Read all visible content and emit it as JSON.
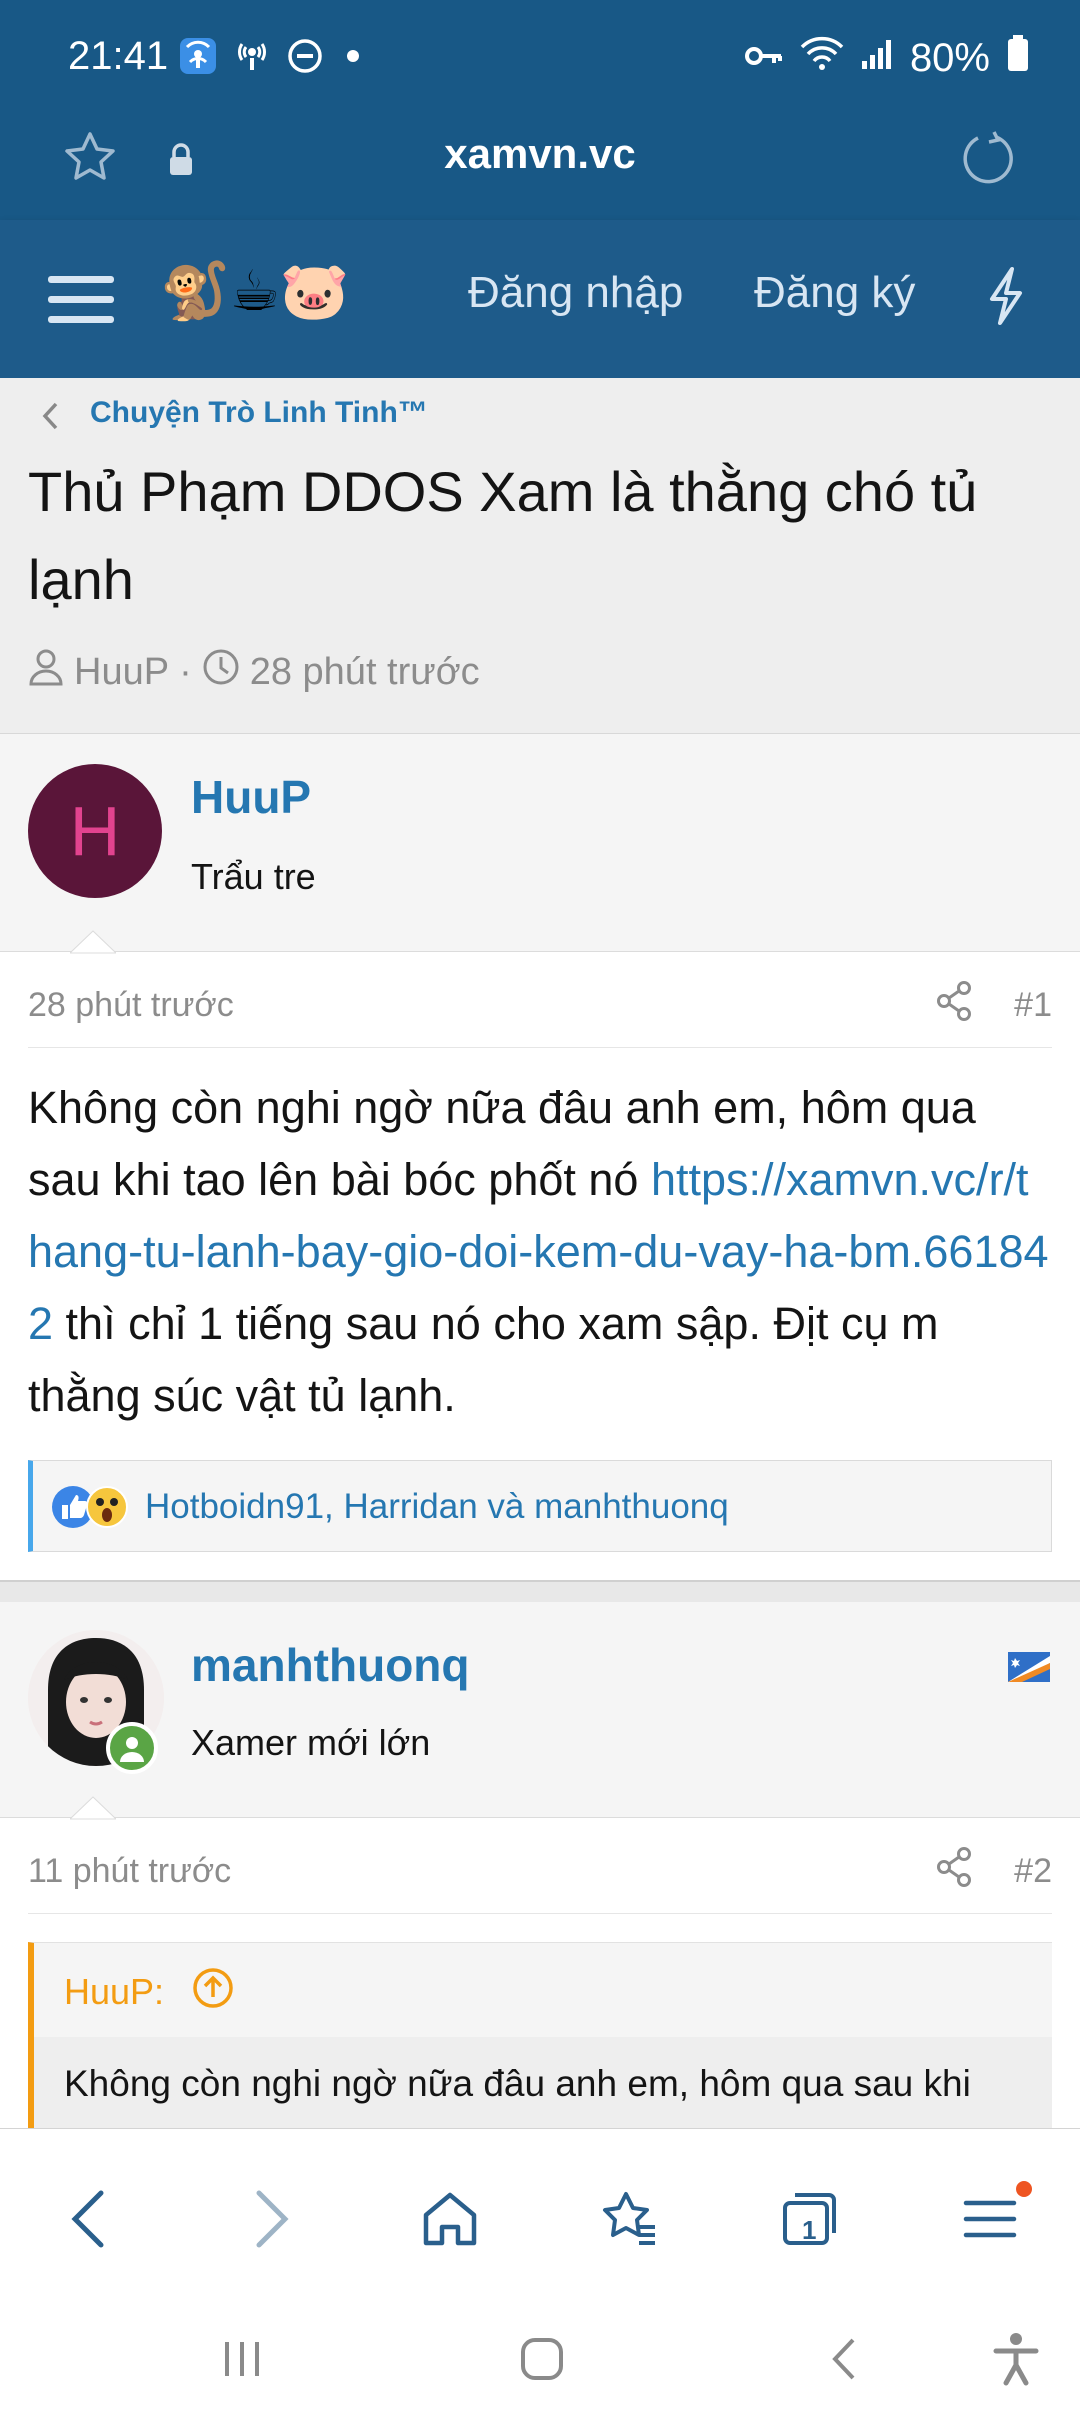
{
  "status_bar": {
    "time": "21:41",
    "battery": "80%"
  },
  "browser": {
    "url": "xamvn.vc",
    "tab_count": "1"
  },
  "site_nav": {
    "emojis": "🐒☕🐷",
    "login": "Đăng nhập",
    "register": "Đăng ký"
  },
  "thread": {
    "breadcrumb": "Chuyện Trò Linh Tinh™",
    "title": "Thủ Phạm DDOS Xam là thằng chó tủ lạnh",
    "author": "HuuP",
    "separator": "·",
    "time": "28 phút trước"
  },
  "posts": [
    {
      "avatar_letter": "H",
      "username": "HuuP",
      "user_title": "Trẩu tre",
      "time": "28 phút trước",
      "number": "#1",
      "body_text_1": "Không còn nghi ngờ nữa đâu anh em, hôm qua sau khi tao lên bài bóc phốt nó ",
      "body_link": "https://xamvn.vc/r/thang-tu-lanh-bay-gio-doi-kem-du-vay-ha-bm.661842",
      "body_text_2": " thì chỉ 1 tiếng sau nó cho xam sập. Địt cụ m thằng súc vật tủ lạnh.",
      "reactions": "Hotboidn91, Harridan và manhthuonq"
    },
    {
      "username": "manhthuonq",
      "user_title": "Xamer mới lớn",
      "time": "11 phút trước",
      "number": "#2",
      "quote_author": "HuuP:",
      "quote_text": "Không còn nghi ngờ nữa đâu anh em, hôm qua sau khi"
    }
  ],
  "colors": {
    "header": "#185886",
    "nav": "#1e5b8a",
    "link": "#2577b1",
    "quote_accent": "#f39c12",
    "avatar_bg": "#5a1539",
    "avatar_letter": "#e2438f"
  }
}
